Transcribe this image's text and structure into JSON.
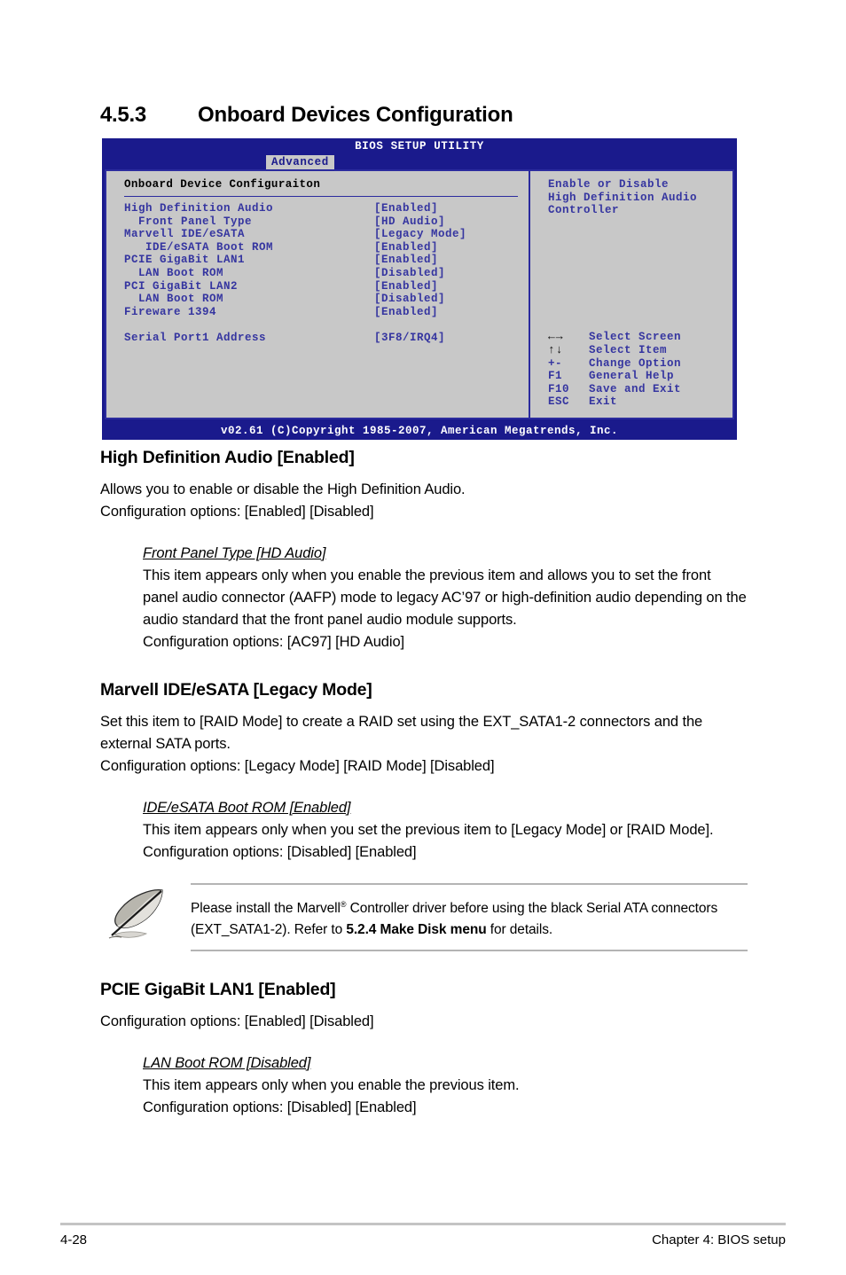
{
  "section": {
    "number": "4.5.3",
    "title": "Onboard Devices Configuration"
  },
  "bios": {
    "title": "BIOS SETUP UTILITY",
    "tab": "Advanced",
    "panel_heading": "Onboard Device Configuraiton",
    "options": [
      {
        "label": "High Definition Audio",
        "value": "[Enabled]"
      },
      {
        "label": "  Front Panel Type",
        "value": "[HD Audio]"
      },
      {
        "label": "Marvell IDE/eSATA",
        "value": "[Legacy Mode]"
      },
      {
        "label": "   IDE/eSATA Boot ROM",
        "value": "[Enabled]"
      },
      {
        "label": "PCIE GigaBit LAN1",
        "value": "[Enabled]"
      },
      {
        "label": "  LAN Boot ROM",
        "value": "[Disabled]"
      },
      {
        "label": "PCI GigaBit LAN2",
        "value": "[Enabled]"
      },
      {
        "label": "  LAN Boot ROM",
        "value": "[Disabled]"
      },
      {
        "label": "Fireware 1394",
        "value": "[Enabled]"
      }
    ],
    "options_extra": [
      {
        "label": "Serial Port1 Address",
        "value": "[3F8/IRQ4]"
      }
    ],
    "help": "Enable or Disable\nHigh Definition Audio\nController",
    "legend": [
      {
        "key": "←→",
        "icon": true,
        "label": "Select Screen"
      },
      {
        "key": "↑↓",
        "icon": true,
        "label": "Select Item"
      },
      {
        "key": "+-",
        "icon": false,
        "label": "Change Option"
      },
      {
        "key": "F1",
        "icon": false,
        "label": "General Help"
      },
      {
        "key": "F10",
        "icon": false,
        "label": "Save and Exit"
      },
      {
        "key": "ESC",
        "icon": false,
        "label": "Exit"
      }
    ],
    "footer": "v02.61 (C)Copyright 1985-2007, American Megatrends, Inc.",
    "colors": {
      "chrome_blue": "#1a1a8c",
      "panel_gray": "#c8c8c8",
      "text_blue": "#3535a0"
    }
  },
  "body": {
    "hda": {
      "heading": "High Definition Audio [Enabled]",
      "line1": "Allows you to enable or disable the High Definition Audio.",
      "line2": "Configuration options: [Enabled] [Disabled]",
      "sub_heading": "Front Panel Type [HD Audio]",
      "sub_para": "This item appears only when you enable the previous item and allows you to set the front panel audio connector (AAFP) mode to legacy AC’97 or high-definition audio depending on the audio standard that the front panel audio module supports.",
      "sub_options": "Configuration options: [AC97] [HD Audio]"
    },
    "marvell": {
      "heading": "Marvell IDE/eSATA [Legacy Mode]",
      "line1": "Set this item to [RAID Mode] to create a RAID set using the EXT_SATA1-2 connectors and the external SATA ports.",
      "line2": "Configuration options: [Legacy Mode] [RAID Mode] [Disabled]",
      "sub_heading": "IDE/eSATA Boot ROM [Enabled]",
      "sub_para": "This item appears only when you set the previous item to [Legacy Mode] or [RAID Mode].",
      "sub_options": "Configuration options: [Disabled] [Enabled]"
    },
    "note": {
      "text_1": "Please install the Marvell",
      "reg": "®",
      "text_2": " Controller driver before using the black Serial ATA connectors (EXT_SATA1-2). Refer to ",
      "bold": "5.2.4 Make Disk menu",
      "text_3": " for details."
    },
    "pcie": {
      "heading": "PCIE GigaBit LAN1 [Enabled]",
      "line1": "Configuration options: [Enabled] [Disabled]",
      "sub_heading": "LAN Boot ROM [Disabled]",
      "sub_para": "This item appears only when you enable the previous item.",
      "sub_options": "Configuration options: [Disabled] [Enabled]"
    }
  },
  "page": {
    "number": "4-28",
    "chapter": "Chapter 4: BIOS setup"
  }
}
